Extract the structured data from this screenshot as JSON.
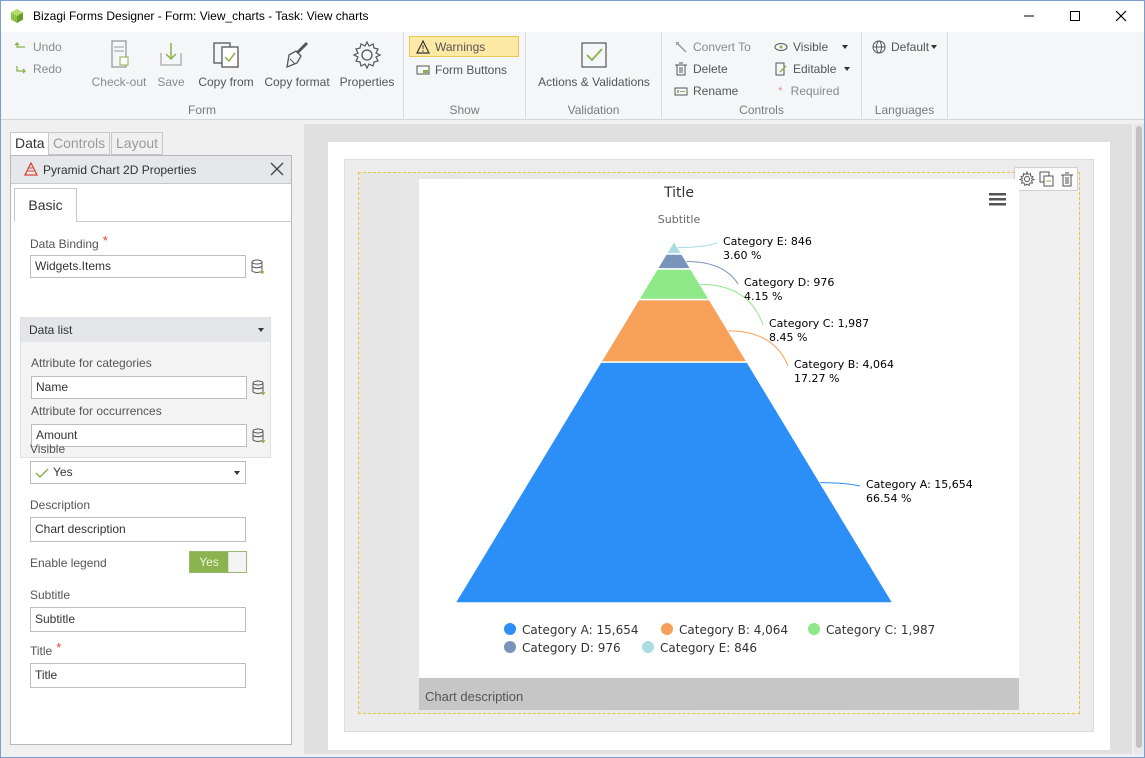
{
  "window": {
    "title": "Bizagi Forms Designer  - Form: View_charts - Task:  View charts",
    "minimize_glyph": "─",
    "maximize_glyph": "☐",
    "close_glyph": "✕"
  },
  "ribbon": {
    "undo": "Undo",
    "redo": "Redo",
    "checkout": "Check-out",
    "save": "Save",
    "copy_from": "Copy from",
    "copy_format": "Copy format",
    "properties": "Properties",
    "form_group": "Form",
    "warnings": "Warnings",
    "form_buttons": "Form Buttons",
    "show_group": "Show",
    "actions_validations": "Actions & Validations",
    "validation_group": "Validation",
    "convert_to": "Convert To",
    "delete": "Delete",
    "rename": "Rename",
    "visible": "Visible",
    "editable": "Editable",
    "required": "Required",
    "controls_group": "Controls",
    "default_lang": "Default",
    "languages_group": "Languages"
  },
  "left_panel": {
    "tabs": [
      "Data",
      "Controls",
      "Layout"
    ],
    "panel_title": "Pyramid Chart 2D Properties",
    "basic_tab": "Basic",
    "data_binding_label": "Data Binding",
    "data_binding_value": "Widgets.Items",
    "data_list_label": "Data list",
    "attr_categories_label": "Attribute for categories",
    "attr_categories_value": "Name",
    "attr_occurrences_label": "Attribute for occurrences",
    "attr_occurrences_value": "Amount",
    "visible_label": "Visible",
    "visible_value": "Yes",
    "description_label": "Description",
    "description_value": "Chart description",
    "enable_legend_label": "Enable legend",
    "enable_legend_value": "Yes",
    "subtitle_label": "Subtitle",
    "subtitle_value": "Subtitle",
    "title_label": "Title",
    "title_value": "Title",
    "required_mark": "*"
  },
  "chart_description": "Chart description",
  "colors": {
    "accent_yellow": "#e8c33a",
    "toggle_green": "#8bb34f",
    "required_red": "#e43b3b"
  },
  "chart_data": {
    "type": "pyramid",
    "title": "Title",
    "subtitle": "Subtitle",
    "series": [
      {
        "name": "Category A",
        "value": 15654,
        "value_label": "15,654",
        "percent": "66.54 %",
        "color": "#2b8ff7"
      },
      {
        "name": "Category B",
        "value": 4064,
        "value_label": "4,064",
        "percent": "17.27 %",
        "color": "#f6a05a"
      },
      {
        "name": "Category C",
        "value": 1987,
        "value_label": "1,987",
        "percent": "8.45 %",
        "color": "#8ee887"
      },
      {
        "name": "Category D",
        "value": 976,
        "value_label": "976",
        "percent": "4.15 %",
        "color": "#7a93bb"
      },
      {
        "name": "Category E",
        "value": 846,
        "value_label": "846",
        "percent": "3.60 %",
        "color": "#a9dde3"
      }
    ],
    "legend_position": "bottom"
  }
}
